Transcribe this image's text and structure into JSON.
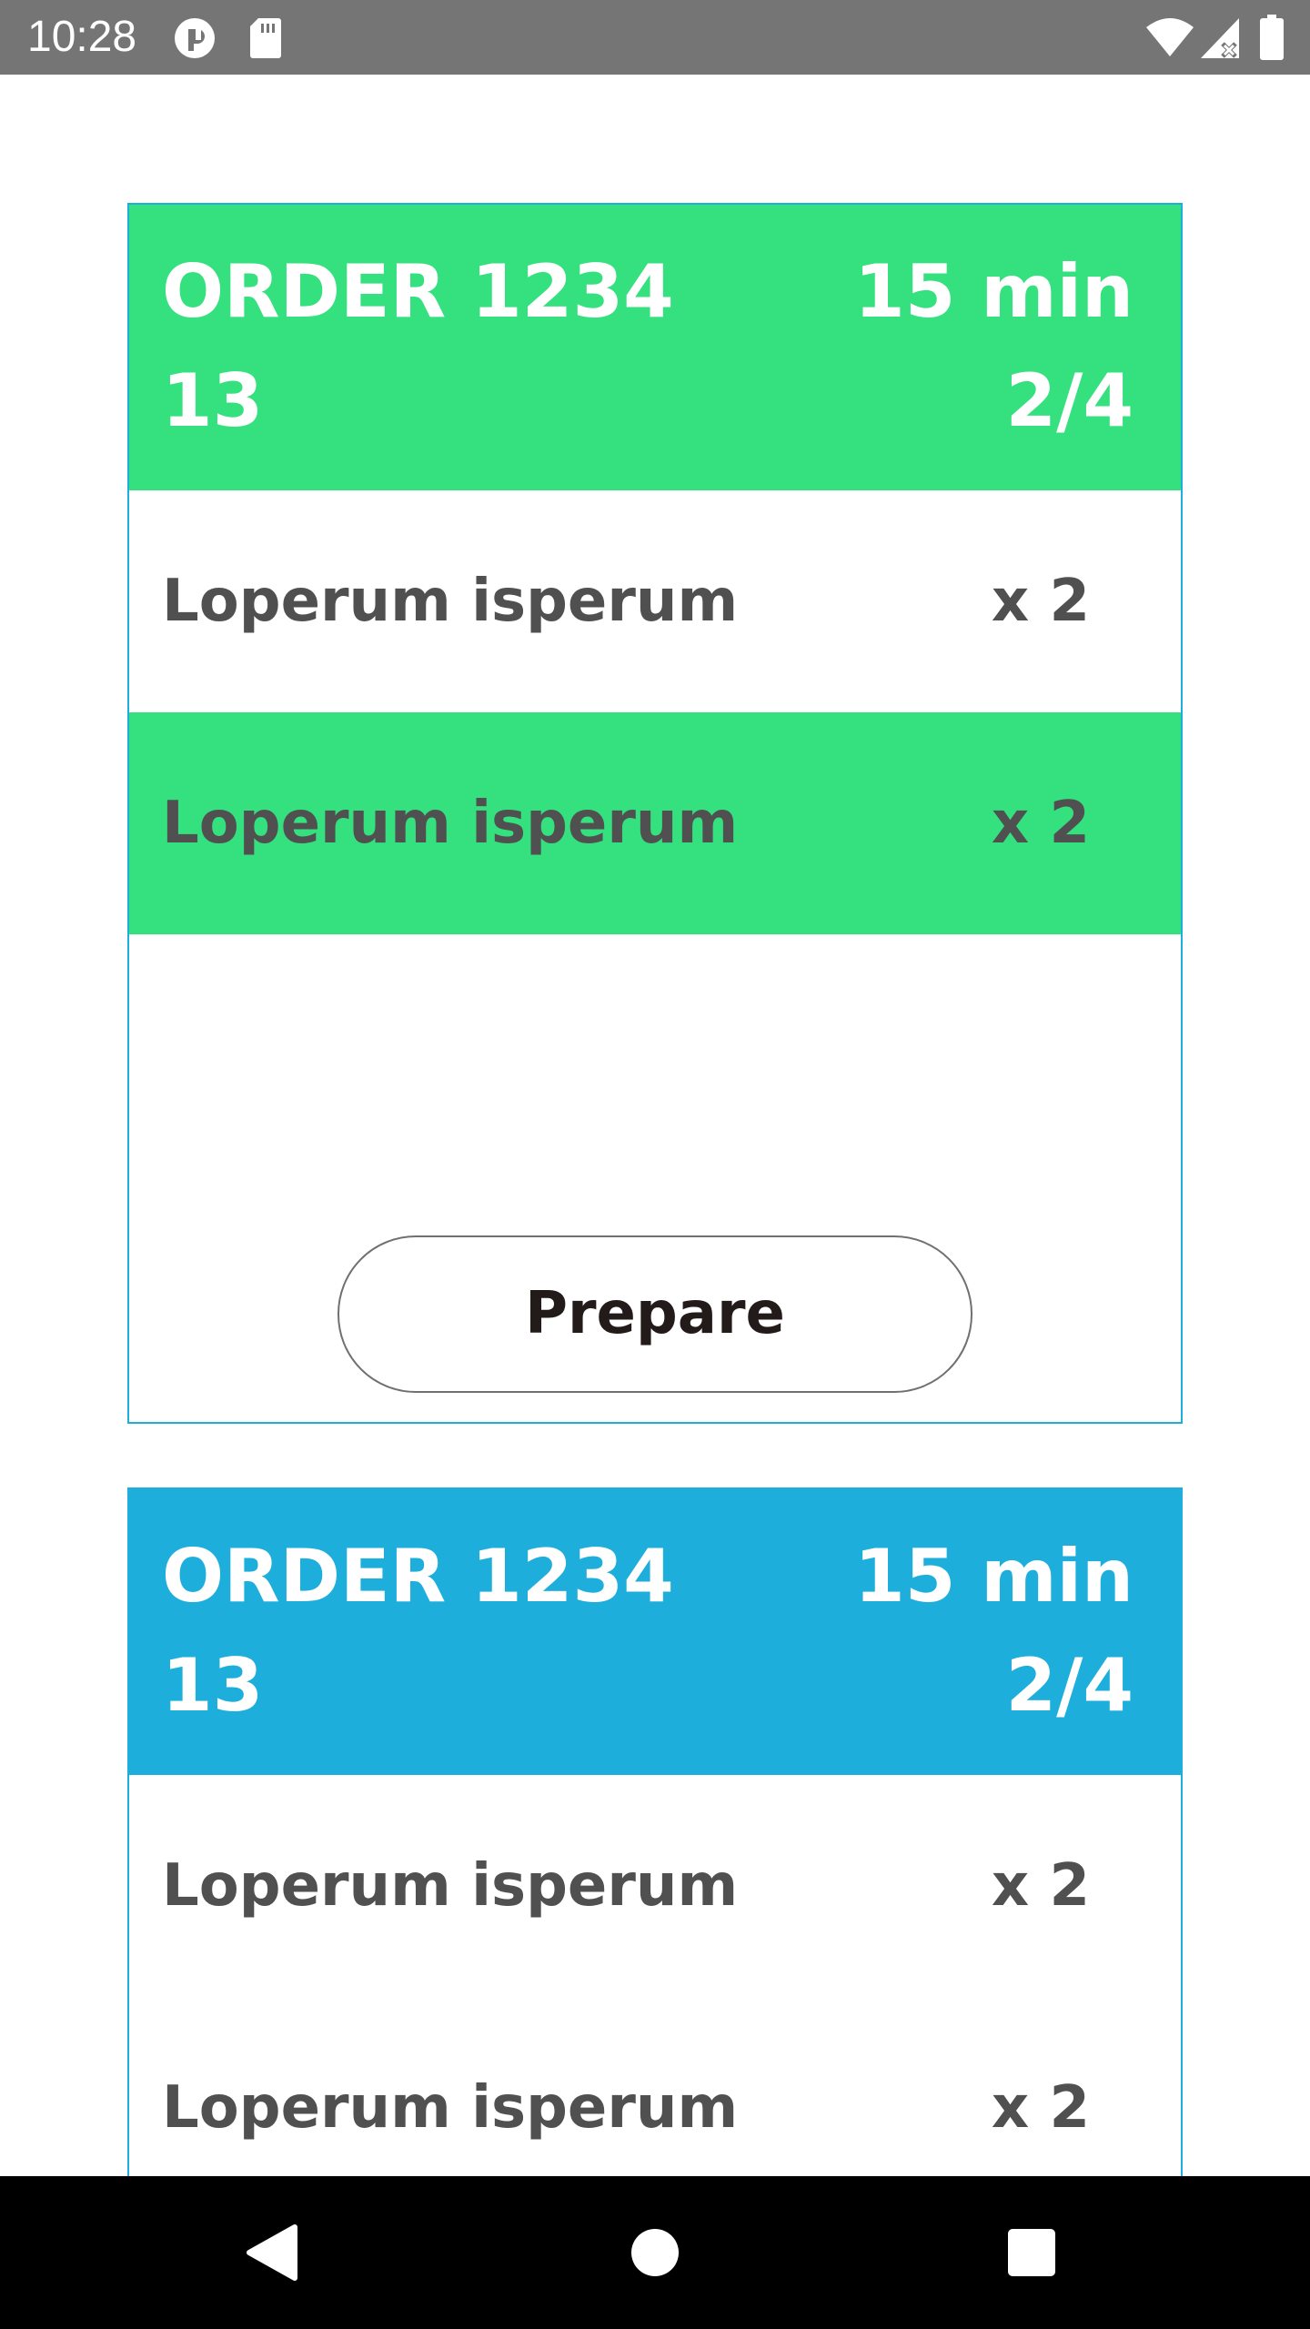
{
  "status_bar": {
    "time": "10:28",
    "icons": [
      "notification-icon",
      "sd-card-icon",
      "wifi-icon",
      "cell-signal-icon",
      "battery-icon"
    ]
  },
  "orders": [
    {
      "title": "ORDER 1234",
      "table": "13",
      "time": "15 min",
      "progress": "2/4",
      "header_color": "#35e07e",
      "items": [
        {
          "name": "Loperum isperum",
          "qty": "x 2",
          "highlighted": false
        },
        {
          "name": "Loperum isperum",
          "qty": "x 2",
          "highlighted": true
        }
      ],
      "button_label": "Prepare"
    },
    {
      "title": "ORDER 1234",
      "table": "13",
      "time": "15 min",
      "progress": "2/4",
      "header_color": "#1eaedb",
      "items": [
        {
          "name": "Loperum isperum",
          "qty": "x 2",
          "highlighted": false
        },
        {
          "name": "Loperum isperum",
          "qty": "x 2",
          "highlighted": false
        }
      ]
    }
  ],
  "nav_bar": {
    "buttons": [
      "back-icon",
      "home-icon",
      "recents-icon"
    ]
  },
  "colors": {
    "status_bar": "#757575",
    "accent_green": "#35e07e",
    "accent_blue": "#1eaedb",
    "item_text": "#505050",
    "button_text": "#231a1a"
  }
}
